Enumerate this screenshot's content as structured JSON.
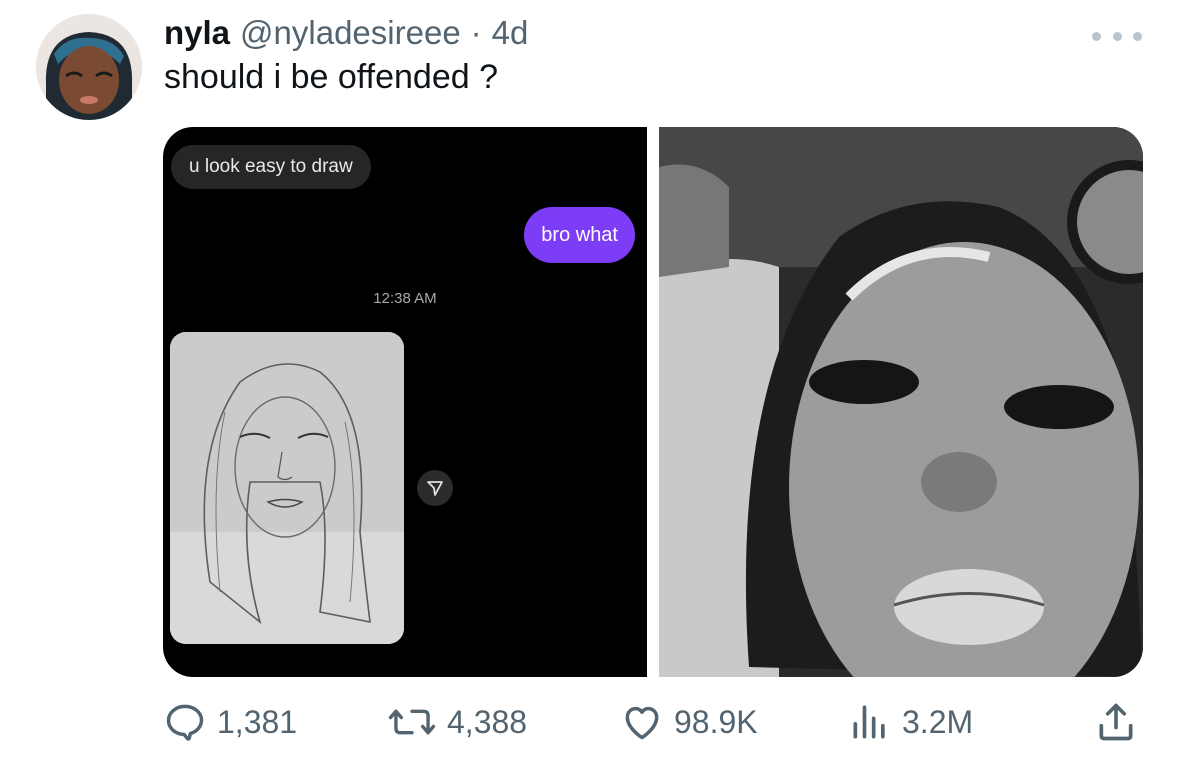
{
  "tweet": {
    "display_name": "nyla",
    "handle": "@nyladesireee",
    "separator": "·",
    "time": "4d",
    "text": "should i be offended ?"
  },
  "media": {
    "left_screenshot": {
      "incoming_message": "u look easy to draw",
      "outgoing_message": "bro what",
      "timestamp": "12:38 AM",
      "outgoing_bubble_color": "#7d3cf5"
    }
  },
  "actions": {
    "replies": "1,381",
    "reposts": "4,388",
    "likes": "98.9K",
    "views": "3.2M"
  },
  "icons": [
    "more-icon",
    "reply-icon",
    "repost-icon",
    "like-icon",
    "views-icon",
    "share-icon",
    "send-icon"
  ]
}
